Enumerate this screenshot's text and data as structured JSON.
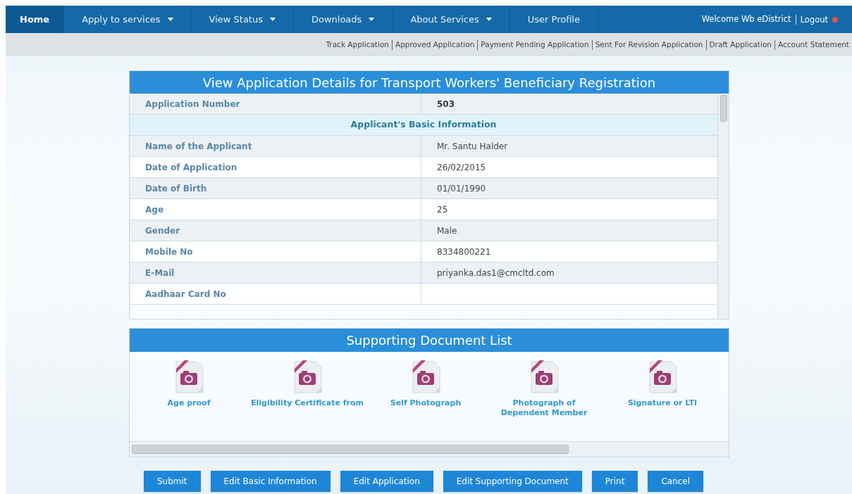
{
  "nav": {
    "items": [
      {
        "label": "Home",
        "selected": true,
        "dropdown": false
      },
      {
        "label": "Apply to services",
        "selected": false,
        "dropdown": true
      },
      {
        "label": "View Status",
        "selected": false,
        "dropdown": true
      },
      {
        "label": "Downloads",
        "selected": false,
        "dropdown": true
      },
      {
        "label": "About Services",
        "selected": false,
        "dropdown": true
      },
      {
        "label": "User Profile",
        "selected": false,
        "dropdown": false
      }
    ],
    "welcome": "Welcome Wb eDistrict",
    "logout": "Logout"
  },
  "sub_links": [
    "Track Application",
    "Approved Application",
    "Payment Pending Application",
    "Sent For Revision Application",
    "Draft Application",
    "Account Statement"
  ],
  "details": {
    "title": "View Application Details for Transport Workers' Beneficiary Registration",
    "rows": [
      {
        "kind": "field",
        "label": "Application Number",
        "value": "503",
        "bold": true
      },
      {
        "kind": "section",
        "label": "Applicant's Basic Information"
      },
      {
        "kind": "field",
        "label": "Name of the Applicant",
        "value": "Mr. Santu Halder",
        "bold": false
      },
      {
        "kind": "field",
        "label": "Date of Application",
        "value": "26/02/2015",
        "bold": false
      },
      {
        "kind": "field",
        "label": "Date of Birth",
        "value": "01/01/1990",
        "bold": false
      },
      {
        "kind": "field",
        "label": "Age",
        "value": "25",
        "bold": false
      },
      {
        "kind": "field",
        "label": "Gender",
        "value": "Male",
        "bold": false
      },
      {
        "kind": "field",
        "label": "Mobile No",
        "value": "8334800221",
        "bold": false
      },
      {
        "kind": "field",
        "label": "E-Mail",
        "value": "priyanka.das1@cmcltd.com",
        "bold": false
      },
      {
        "kind": "field",
        "label": "Aadhaar Card No"
      }
    ]
  },
  "documents": {
    "title": "Supporting Document List",
    "items": [
      {
        "label": "Age proof"
      },
      {
        "label": "Eligibility Certificate from"
      },
      {
        "label": "Self Photograph"
      },
      {
        "label": "Photograph of Dependent Member"
      },
      {
        "label": "Signature or LTI"
      }
    ]
  },
  "buttons": [
    "Submit",
    "Edit Basic Information",
    "Edit Application",
    "Edit Supporting Document",
    "Print",
    "Cancel"
  ]
}
